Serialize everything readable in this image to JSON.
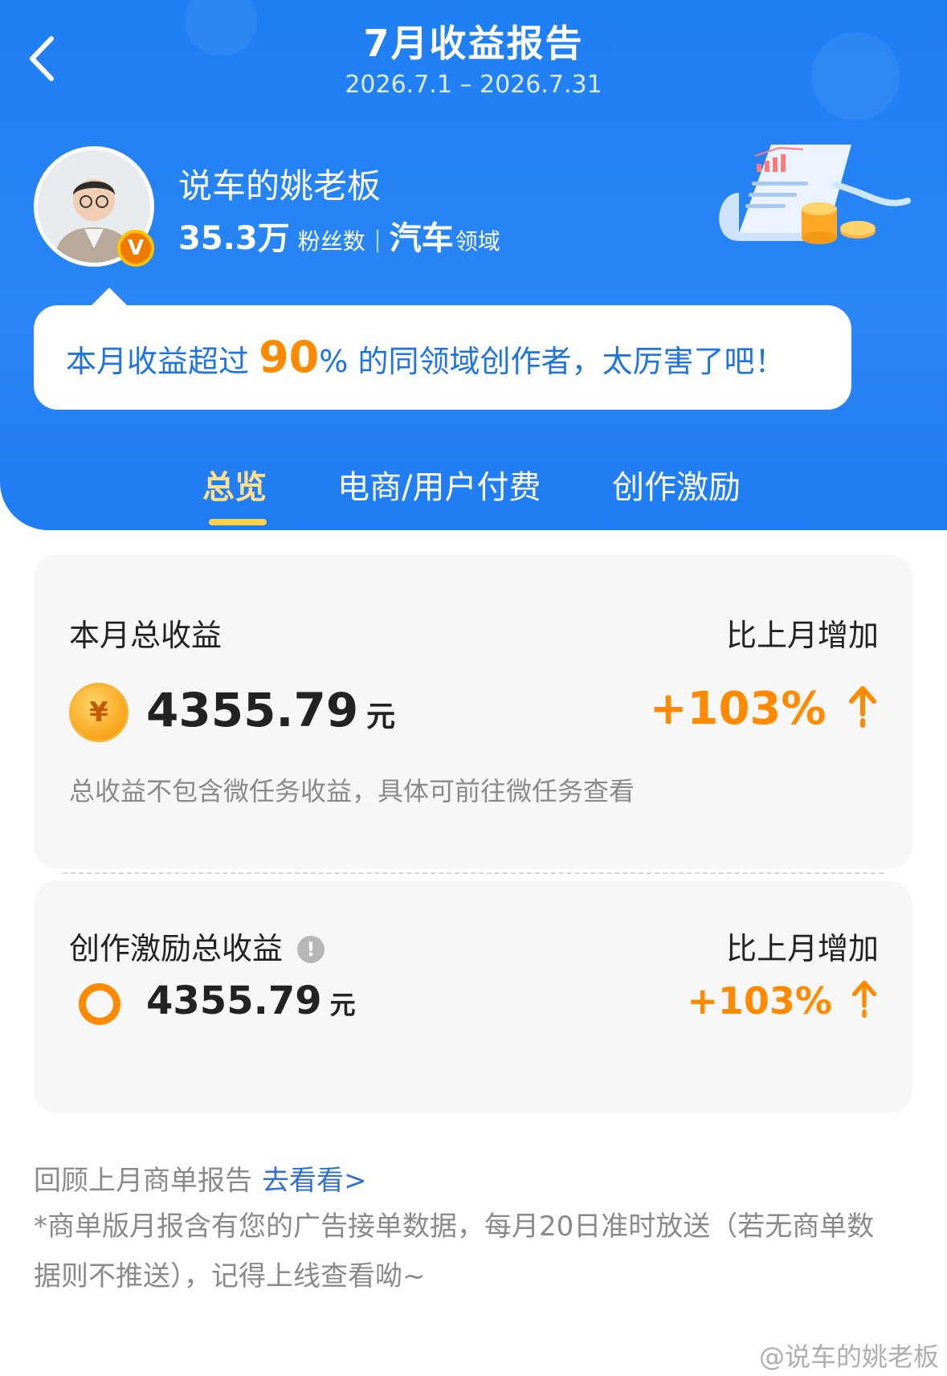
{
  "header": {
    "title": "7月收益报告",
    "date_range": "2026.7.1 – 2026.7.31"
  },
  "profile": {
    "name": "说车的姚老板",
    "verified_badge": "V",
    "fans_count": "35.3万",
    "fans_label": "粉丝数",
    "domain": "汽车",
    "domain_label": "领域"
  },
  "rank": {
    "prefix": "本月收益超过 ",
    "percent": "90",
    "percent_sign": "%",
    "suffix": " 的同领域创作者，太厉害了吧！"
  },
  "tabs": [
    {
      "label": "总览",
      "active": true
    },
    {
      "label": "电商/用户付费",
      "active": false
    },
    {
      "label": "创作激励",
      "active": false
    }
  ],
  "total_income": {
    "label": "本月总收益",
    "compare_label": "比上月增加",
    "coin_symbol": "¥",
    "amount": "4355.79",
    "unit": "元",
    "growth": "+103%",
    "note": "总收益不包含微任务收益，具体可前往微任务查看"
  },
  "incentive_income": {
    "label": "创作激励总收益",
    "info": "!",
    "compare_label": "比上月增加",
    "amount": "4355.79",
    "unit": "元",
    "growth": "+103%"
  },
  "review": {
    "text": "回顾上月商单报告",
    "link": "去看看>"
  },
  "footer_note": "*商单版月报含有您的广告接单数据，每月20日准时放送（若无商单数据则不推送），记得上线查看呦~",
  "watermark": "@说车的姚老板",
  "colors": {
    "header_blue": "#1e7ff3",
    "accent_orange": "#ff8a00",
    "link_blue": "#2f6fd6"
  }
}
